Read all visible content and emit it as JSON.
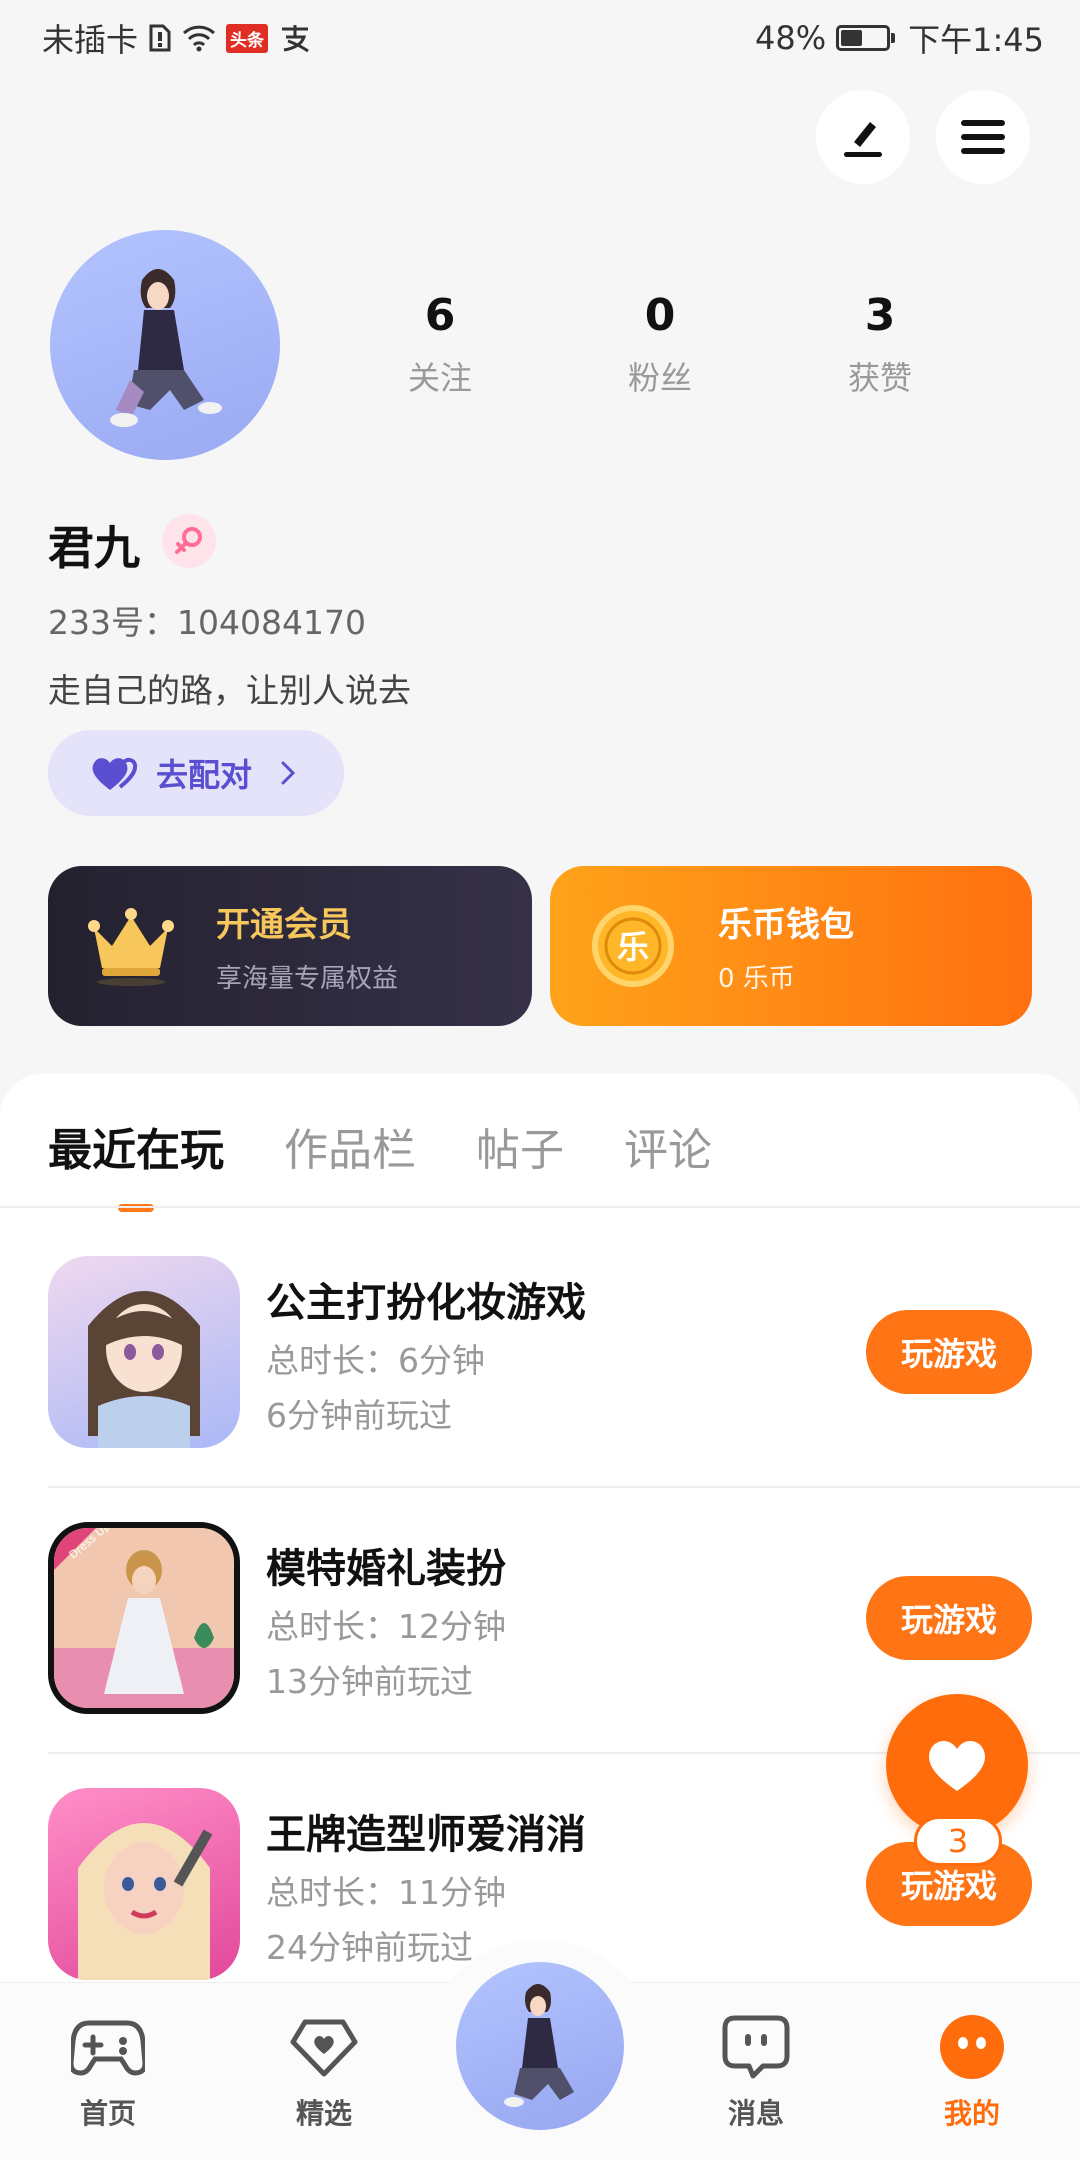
{
  "status_bar": {
    "carrier": "未插卡",
    "news_badge": "头条",
    "battery": "48%",
    "battery_level": 0.48,
    "time": "下午1:45"
  },
  "header": {
    "edit_icon": "pencil-icon",
    "menu_icon": "hamburger-menu-icon"
  },
  "profile": {
    "stats": [
      {
        "value": "6",
        "label": "关注"
      },
      {
        "value": "0",
        "label": "粉丝"
      },
      {
        "value": "3",
        "label": "获赞"
      }
    ],
    "username": "君九",
    "gender_icon": "female-icon",
    "id_text": "233号：104084170",
    "bio": "走自己的路，让别人说去",
    "match_button": "去配对"
  },
  "cards": {
    "vip": {
      "title": "开通会员",
      "subtitle": "享海量专属权益"
    },
    "wallet": {
      "title": "乐币钱包",
      "subtitle": "0 乐币",
      "coin_char": "乐"
    }
  },
  "tabs": [
    "最近在玩",
    "作品栏",
    "帖子",
    "评论"
  ],
  "games": [
    {
      "name": "公主打扮化妆游戏",
      "duration": "总时长：6分钟",
      "last_played": "6分钟前玩过",
      "button": "玩游戏"
    },
    {
      "name": "模特婚礼装扮",
      "duration": "总时长：12分钟",
      "last_played": "13分钟前玩过",
      "button": "玩游戏",
      "thumb_text": "Dress Up"
    },
    {
      "name": "王牌造型师爱消消",
      "duration": "总时长：11分钟",
      "last_played": "24分钟前玩过",
      "button": "玩游戏"
    }
  ],
  "float": {
    "badge": "3"
  },
  "bottom_nav": [
    {
      "label": "首页",
      "icon": "gamepad-icon"
    },
    {
      "label": "精选",
      "icon": "heart-diamond-icon"
    },
    {
      "label": "消息",
      "icon": "chat-bubble-icon"
    },
    {
      "label": "我的",
      "icon": "smiley-face-icon"
    }
  ],
  "colors": {
    "accent": "#ff6c0c",
    "match": "#5a4fd1",
    "vip_gold": "#f7c75c"
  }
}
